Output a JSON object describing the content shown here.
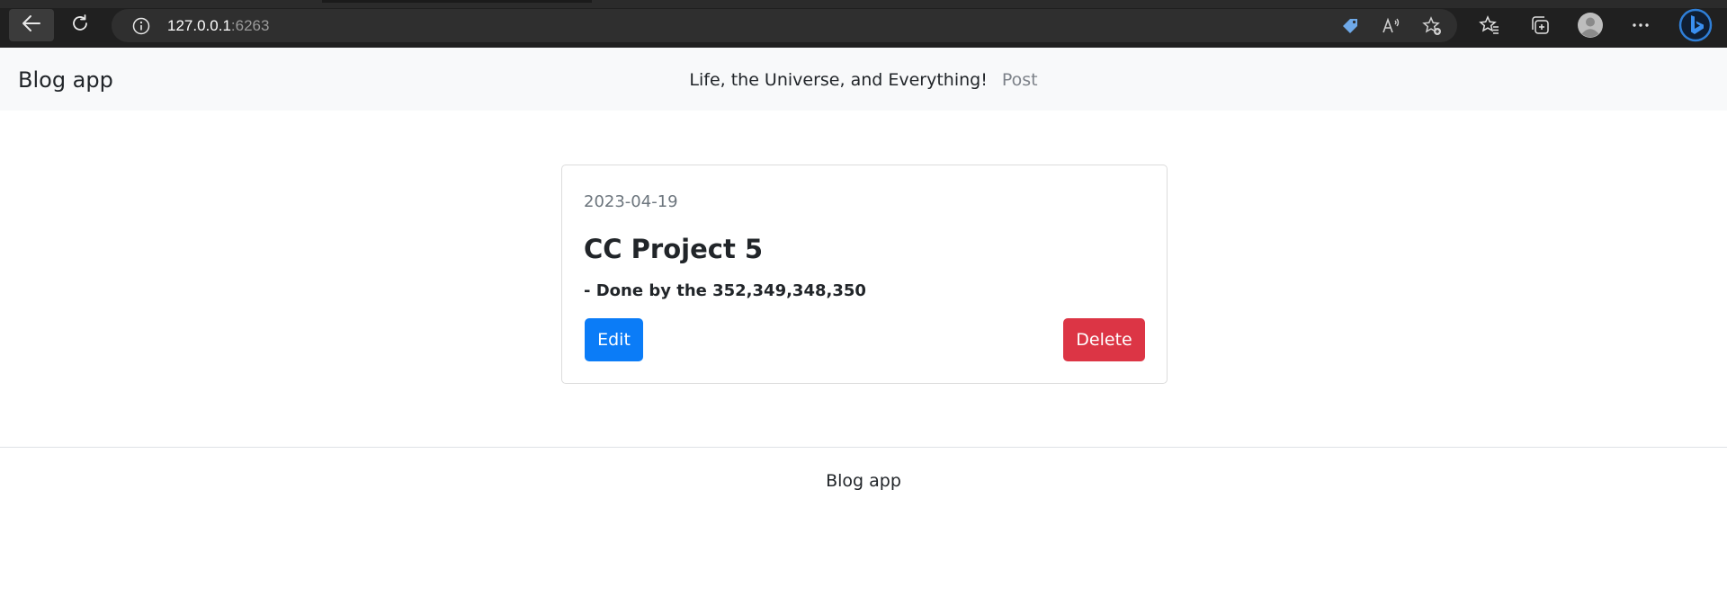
{
  "browser": {
    "url_host": "127.0.0.1",
    "url_port": ":6263",
    "icons": [
      "back-arrow-icon",
      "reload-icon",
      "info-icon",
      "price-tag-icon",
      "read-aloud-icon",
      "add-favorite-icon",
      "favorites-icon",
      "collections-icon",
      "profile-icon",
      "more-icon",
      "bing-icon"
    ]
  },
  "navbar": {
    "brand": "Blog app",
    "links": {
      "main": "Life, the Universe, and Everything!",
      "post": "Post"
    }
  },
  "card": {
    "date": "2023-04-19",
    "title": "CC Project 5",
    "subtitle": "- Done by the 352,349,348,350",
    "edit_label": "Edit",
    "delete_label": "Delete"
  },
  "footer": {
    "text": "Blog app"
  },
  "colors": {
    "edit_button": "#0b7cf7",
    "delete_button": "#dc3545",
    "navbar_bg": "#f8f9fa",
    "browser_bg": "#202020"
  }
}
